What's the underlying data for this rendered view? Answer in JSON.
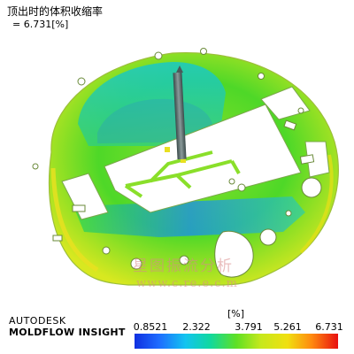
{
  "header": {
    "title": "顶出时的体积收缩率",
    "value_prefix": "= ",
    "value": "6.731",
    "unit": "[%]"
  },
  "brand": {
    "top": "AUTODESK",
    "bottom": "MOLDFLOW INSIGHT"
  },
  "scale": {
    "unit": "[%]",
    "labels": [
      "0.8521",
      "2.322",
      "3.791",
      "5.261",
      "6.731"
    ],
    "colors": [
      "#1030e0",
      "#12c4f0",
      "#5ee024",
      "#f0e010",
      "#e81010"
    ]
  },
  "watermark": {
    "cn": "星图振流分析",
    "url": "www.c.re.e.c.m"
  }
}
